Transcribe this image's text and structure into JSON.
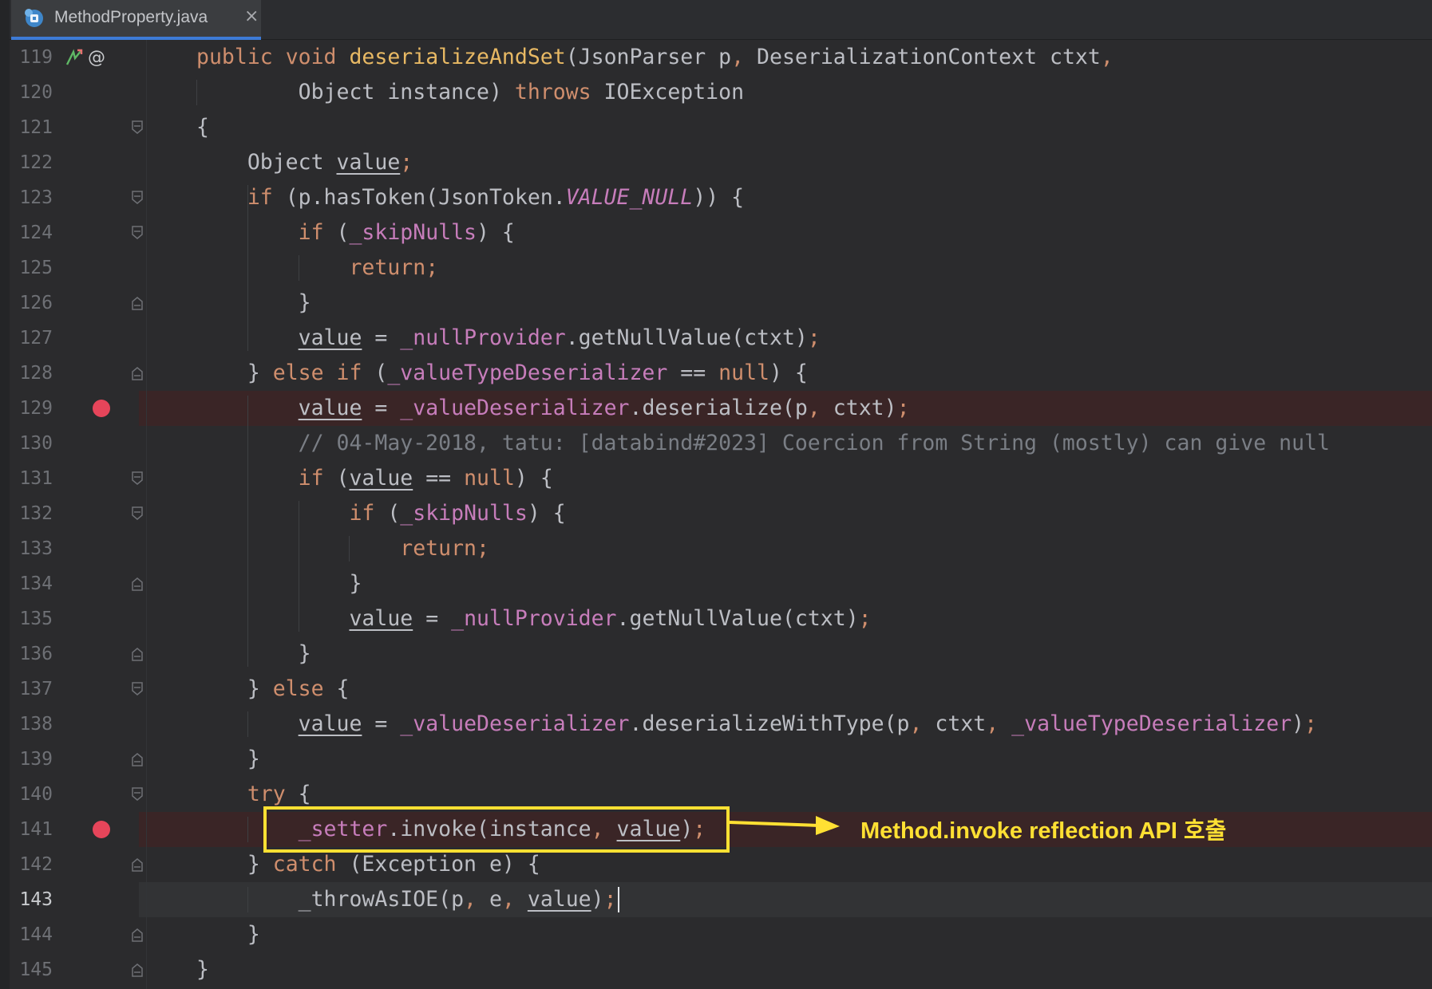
{
  "tab": {
    "title": "MethodProperty.java",
    "close_glyph": "×",
    "icon": "java-class-icon",
    "active_underline_color": "#3d7bd6"
  },
  "gutter": {
    "line_119_icons": [
      "implements-method-icon",
      "annotation-icon"
    ],
    "at_glyph": "@",
    "breakpoint_color": "#e6455a"
  },
  "lines": [
    {
      "n": "119",
      "tokens": [
        [
          "kw",
          "public "
        ],
        [
          "kw",
          "void "
        ],
        [
          "decl",
          "deserializeAndSet"
        ],
        [
          "plain",
          "(JsonParser p"
        ],
        [
          "punct",
          ", "
        ],
        [
          "plain",
          "DeserializationContext ctxt"
        ],
        [
          "punct",
          ","
        ]
      ]
    },
    {
      "n": "120",
      "tokens": [
        [
          "plain",
          "        Object instance) "
        ],
        [
          "kw",
          "throws "
        ],
        [
          "plain",
          "IOException"
        ]
      ]
    },
    {
      "n": "121",
      "tokens": [
        [
          "plain",
          "{"
        ]
      ]
    },
    {
      "n": "122",
      "tokens": [
        [
          "plain",
          "    Object "
        ],
        [
          "local",
          "value"
        ],
        [
          "punct",
          ";"
        ]
      ]
    },
    {
      "n": "123",
      "tokens": [
        [
          "kw",
          "    if "
        ],
        [
          "plain",
          "(p.hasToken(JsonToken."
        ],
        [
          "const",
          "VALUE_NULL"
        ],
        [
          "plain",
          ")) {"
        ]
      ]
    },
    {
      "n": "124",
      "tokens": [
        [
          "kw",
          "        if "
        ],
        [
          "plain",
          "("
        ],
        [
          "field",
          "_skipNulls"
        ],
        [
          "plain",
          ") {"
        ]
      ]
    },
    {
      "n": "125",
      "tokens": [
        [
          "kw",
          "            return"
        ],
        [
          "punct",
          ";"
        ]
      ]
    },
    {
      "n": "126",
      "tokens": [
        [
          "plain",
          "        }"
        ]
      ]
    },
    {
      "n": "127",
      "tokens": [
        [
          "plain",
          "        "
        ],
        [
          "local",
          "value"
        ],
        [
          "plain",
          " = "
        ],
        [
          "field",
          "_nullProvider"
        ],
        [
          "plain",
          ".getNullValue(ctxt)"
        ],
        [
          "punct",
          ";"
        ]
      ]
    },
    {
      "n": "128",
      "tokens": [
        [
          "plain",
          "    } "
        ],
        [
          "kw",
          "else if "
        ],
        [
          "plain",
          "("
        ],
        [
          "field",
          "_valueTypeDeserializer"
        ],
        [
          "plain",
          " == "
        ],
        [
          "kw",
          "null"
        ],
        [
          "plain",
          ") {"
        ]
      ]
    },
    {
      "n": "129",
      "tokens": [
        [
          "plain",
          "        "
        ],
        [
          "local",
          "value"
        ],
        [
          "plain",
          " = "
        ],
        [
          "field",
          "_valueDeserializer"
        ],
        [
          "plain",
          ".deserialize(p"
        ],
        [
          "punct",
          ", "
        ],
        [
          "plain",
          "ctxt)"
        ],
        [
          "punct",
          ";"
        ]
      ],
      "breakpoint": true
    },
    {
      "n": "130",
      "tokens": [
        [
          "com",
          "        // 04-May-2018, tatu: [databind#2023] Coercion from String (mostly) can give null"
        ]
      ]
    },
    {
      "n": "131",
      "tokens": [
        [
          "kw",
          "        if "
        ],
        [
          "plain",
          "("
        ],
        [
          "local",
          "value"
        ],
        [
          "plain",
          " == "
        ],
        [
          "kw",
          "null"
        ],
        [
          "plain",
          ") {"
        ]
      ]
    },
    {
      "n": "132",
      "tokens": [
        [
          "kw",
          "            if "
        ],
        [
          "plain",
          "("
        ],
        [
          "field",
          "_skipNulls"
        ],
        [
          "plain",
          ") {"
        ]
      ]
    },
    {
      "n": "133",
      "tokens": [
        [
          "kw",
          "                return"
        ],
        [
          "punct",
          ";"
        ]
      ]
    },
    {
      "n": "134",
      "tokens": [
        [
          "plain",
          "            }"
        ]
      ]
    },
    {
      "n": "135",
      "tokens": [
        [
          "plain",
          "            "
        ],
        [
          "local",
          "value"
        ],
        [
          "plain",
          " = "
        ],
        [
          "field",
          "_nullProvider"
        ],
        [
          "plain",
          ".getNullValue(ctxt)"
        ],
        [
          "punct",
          ";"
        ]
      ]
    },
    {
      "n": "136",
      "tokens": [
        [
          "plain",
          "        }"
        ]
      ]
    },
    {
      "n": "137",
      "tokens": [
        [
          "plain",
          "    } "
        ],
        [
          "kw",
          "else "
        ],
        [
          "plain",
          "{"
        ]
      ]
    },
    {
      "n": "138",
      "tokens": [
        [
          "plain",
          "        "
        ],
        [
          "local",
          "value"
        ],
        [
          "plain",
          " = "
        ],
        [
          "field",
          "_valueDeserializer"
        ],
        [
          "plain",
          ".deserializeWithType(p"
        ],
        [
          "punct",
          ", "
        ],
        [
          "plain",
          "ctxt"
        ],
        [
          "punct",
          ", "
        ],
        [
          "field",
          "_valueTypeDeserializer"
        ],
        [
          "plain",
          ")"
        ],
        [
          "punct",
          ";"
        ]
      ]
    },
    {
      "n": "139",
      "tokens": [
        [
          "plain",
          "    }"
        ]
      ]
    },
    {
      "n": "140",
      "tokens": [
        [
          "kw",
          "    try "
        ],
        [
          "plain",
          "{"
        ]
      ]
    },
    {
      "n": "141",
      "tokens": [
        [
          "plain",
          "        "
        ],
        [
          "field",
          "_setter"
        ],
        [
          "plain",
          ".invoke(instance"
        ],
        [
          "punct",
          ", "
        ],
        [
          "local",
          "value"
        ],
        [
          "plain",
          ")"
        ],
        [
          "punct",
          ";"
        ]
      ],
      "breakpoint": true
    },
    {
      "n": "142",
      "tokens": [
        [
          "plain",
          "    } "
        ],
        [
          "kw",
          "catch "
        ],
        [
          "plain",
          "(Exception e) {"
        ]
      ]
    },
    {
      "n": "143",
      "tokens": [
        [
          "plain",
          "        _throwAsIOE(p"
        ],
        [
          "punct",
          ", "
        ],
        [
          "plain",
          "e"
        ],
        [
          "punct",
          ", "
        ],
        [
          "local",
          "value"
        ],
        [
          "plain",
          ")"
        ],
        [
          "punct",
          ";"
        ]
      ],
      "current": true
    },
    {
      "n": "144",
      "tokens": [
        [
          "plain",
          "    }"
        ]
      ]
    },
    {
      "n": "145",
      "tokens": [
        [
          "plain",
          "}"
        ]
      ]
    }
  ],
  "annotation": {
    "text": "Method.invoke reflection API 호출",
    "color": "#ffe033"
  }
}
